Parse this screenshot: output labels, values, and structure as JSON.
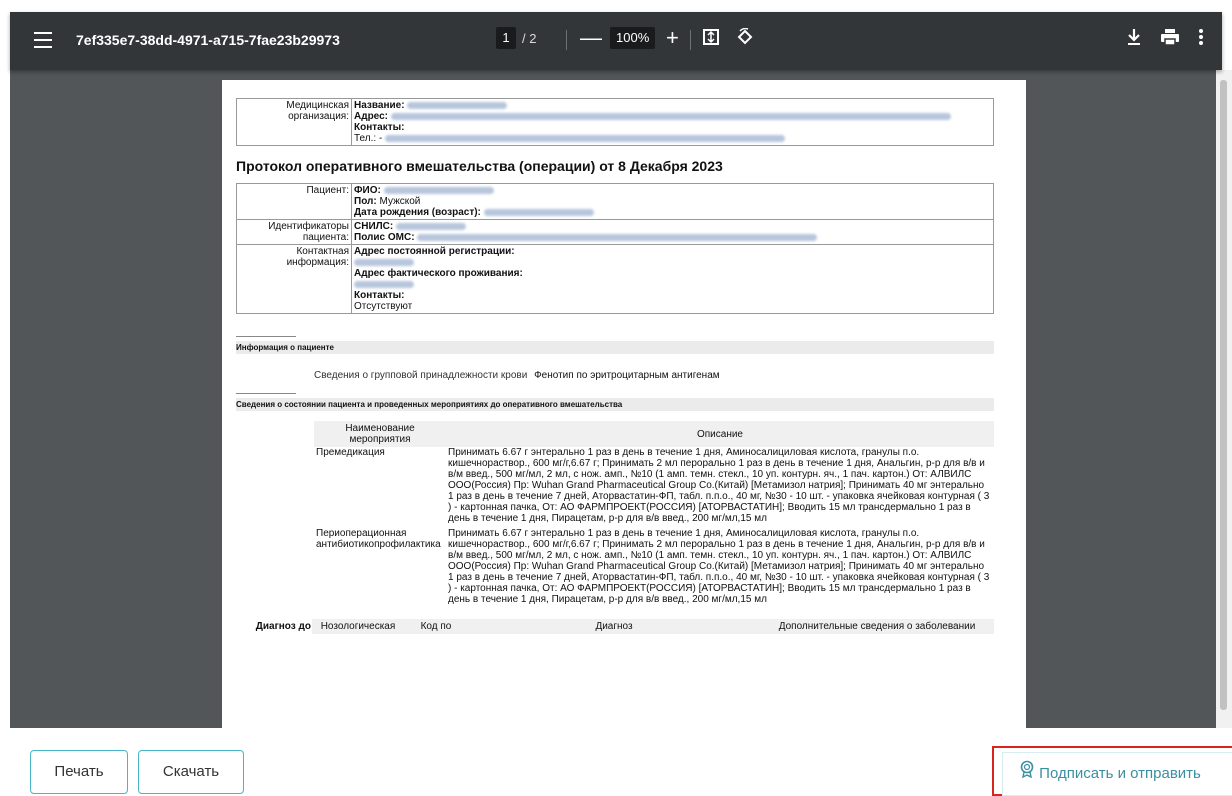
{
  "toolbar": {
    "file_title": "7ef335e7-38dd-4971-a715-7fae23b29973",
    "current_page": "1",
    "page_separator": "/ 2",
    "zoom_minus": "—",
    "zoom": "100%",
    "zoom_plus": "+"
  },
  "document": {
    "org_label": "Медицинская организация:",
    "org_name_label": "Название:",
    "org_address_label": "Адрес:",
    "org_contacts_label": "Контакты:",
    "org_phone_label": "Тел.: -",
    "title": "Протокол оперативного вмешательства (операции) от 8 Декабря 2023",
    "patient_label": "Пациент:",
    "fio_label": "ФИО:",
    "sex_label": "Пол:",
    "sex_value": "Мужской",
    "birth_label": "Дата рождения (возраст):",
    "ids_label": "Идентификаторы пациента:",
    "snils_label": "СНИЛС:",
    "oms_label": "Полис ОМС:",
    "contact_label": "Контактная информация:",
    "reg_address_label": "Адрес постоянной регистрации:",
    "fact_address_label": "Адрес фактического проживания:",
    "contacts_label": "Контакты:",
    "contacts_value": "Отсутствуют",
    "section1": "Информация о пациенте",
    "blood_label": "Сведения о групповой принадлежности крови",
    "blood_value": "Фенотип по эритроцитарным антигенам",
    "section2": "Сведения о состоянии пациента и проведенных мероприятиях до оперативного вмешательства",
    "meas_col1": "Наименование мероприятия",
    "meas_col2": "Описание",
    "measures": [
      {
        "name": "Премедикация",
        "desc": "Принимать 6.67 г энтерально 1 раз в день в течение 1 дня, Аминосалициловая кислота, гранулы п.о. кишечнораствор., 600 мг/г,6.67 г; Принимать 2 мл перорально 1 раз в день в течение 1 дня, Анальгин, р-р для в/в и в/м введ., 500 мг/мл, 2 мл, с нож. амп., №10 (1 амп. темн. стекл., 10 уп. контурн. яч., 1 пач. картон.) От: АЛВИЛС ООО(Россия) Пр: Wuhan Grand Pharmaceutical Group Co.(Китай) [Метамизол натрия]; Принимать 40 мг энтерально 1 раз в день в течение 7 дней, Аторвастатин-ФП, табл. п.п.о., 40 мг, №30 - 10 шт. - упаковка ячейковая контурная ( 3 ) - картонная пачка, От: АО ФАРМПРОЕКТ(РОССИЯ) [АТОРВАСТАТИН]; Вводить 15 мл трансдермально 1 раз в день в течение 1 дня, Пирацетам, р-р для в/в введ., 200 мг/мл,15 мл"
      },
      {
        "name": "Периоперационная антибиотикопрофилактика",
        "desc": "Принимать 6.67 г энтерально 1 раз в день в течение 1 дня, Аминосалициловая кислота, гранулы п.о. кишечнораствор., 600 мг/г,6.67 г; Принимать 2 мл перорально 1 раз в день в течение 1 дня, Анальгин, р-р для в/в и в/м введ., 500 мг/мл, 2 мл, с нож. амп., №10 (1 амп. темн. стекл., 10 уп. контурн. яч., 1 пач. картон.) От: АЛВИЛС ООО(Россия) Пр: Wuhan Grand Pharmaceutical Group Co.(Китай) [Метамизол натрия]; Принимать 40 мг энтерально 1 раз в день в течение 7 дней, Аторвастатин-ФП, табл. п.п.о., 40 мг, №30 - 10 шт. - упаковка ячейковая контурная ( 3 ) - картонная пачка, От: АО ФАРМПРОЕКТ(РОССИЯ) [АТОРВАСТАТИН]; Вводить 15 мл трансдермально 1 раз в день в течение 1 дня, Пирацетам, р-р для в/в введ., 200 мг/мл,15 мл"
      }
    ],
    "diag_label": "Диагноз до",
    "diag_col1": "Нозологическая",
    "diag_col2": "Код по",
    "diag_col3": "Диагноз",
    "diag_col4": "Дополнительные сведения о заболевании"
  },
  "footer": {
    "print_label": "Печать",
    "download_label": "Скачать",
    "sign_label": "Подписать и отправить"
  },
  "colors": {
    "toolbar_bg": "#323639",
    "viewer_bg": "#525659",
    "button_border": "#47b6c8",
    "highlight": "#d9251c"
  }
}
